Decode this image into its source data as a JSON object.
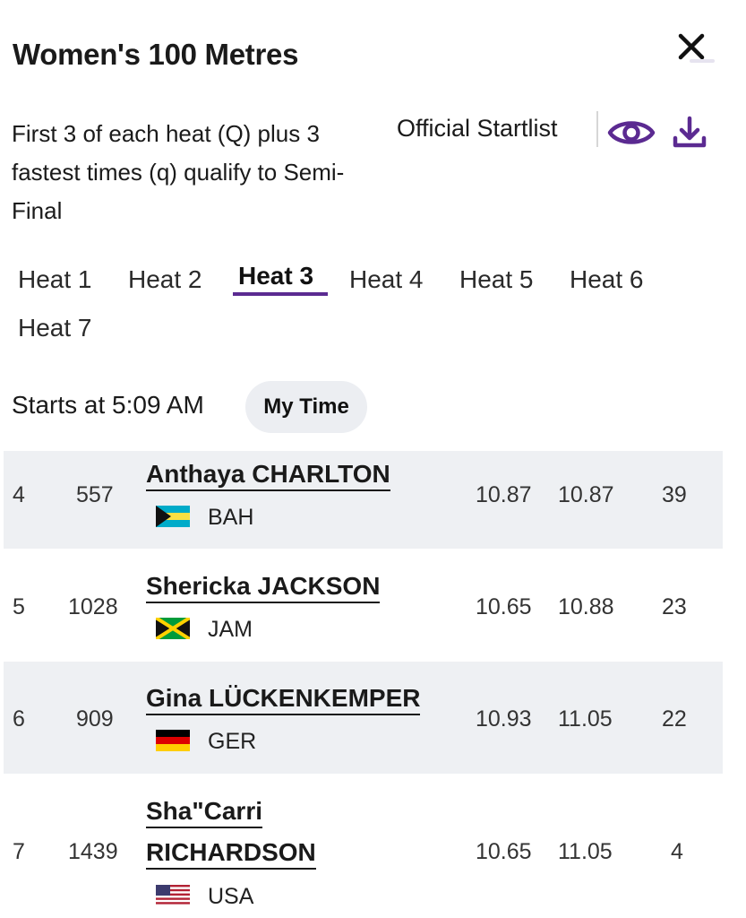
{
  "header": {
    "title": "Women's 100 Metres",
    "description": "First 3 of each heat (Q) plus 3 fastest times (q) qualify to Semi-Final",
    "startlist_label": "Official Startlist"
  },
  "tabs": [
    {
      "label": "Heat 1"
    },
    {
      "label": "Heat 2"
    },
    {
      "label": "Heat 3",
      "active": true
    },
    {
      "label": "Heat 4"
    },
    {
      "label": "Heat 5"
    },
    {
      "label": "Heat 6"
    },
    {
      "label": "Heat 7"
    }
  ],
  "schedule": {
    "starts_text": "Starts at 5:09 AM",
    "my_time_label": "My Time"
  },
  "athletes": [
    {
      "lane": "4",
      "bib": "557",
      "name": "Anthaya CHARLTON",
      "country": "BAH",
      "flag_icon": "bahamas-flag-icon",
      "pb": "10.87",
      "sb": "10.87",
      "rank": "39"
    },
    {
      "lane": "5",
      "bib": "1028",
      "name": "Shericka JACKSON",
      "country": "JAM",
      "flag_icon": "jamaica-flag-icon",
      "pb": "10.65",
      "sb": "10.88",
      "rank": "23"
    },
    {
      "lane": "6",
      "bib": "909",
      "name": "Gina LÜCKENKEMPER",
      "country": "GER",
      "flag_icon": "germany-flag-icon",
      "pb": "10.93",
      "sb": "11.05",
      "rank": "22"
    },
    {
      "lane": "7",
      "bib": "1439",
      "name_line1": "Sha\"Carri",
      "name_line2": "RICHARDSON",
      "country": "USA",
      "flag_icon": "usa-flag-icon",
      "pb": "10.65",
      "sb": "11.05",
      "rank": "4"
    }
  ],
  "colors": {
    "accent": "#5b2a91",
    "row_shade": "#eef0f3",
    "chip_bg": "#eceef2"
  }
}
